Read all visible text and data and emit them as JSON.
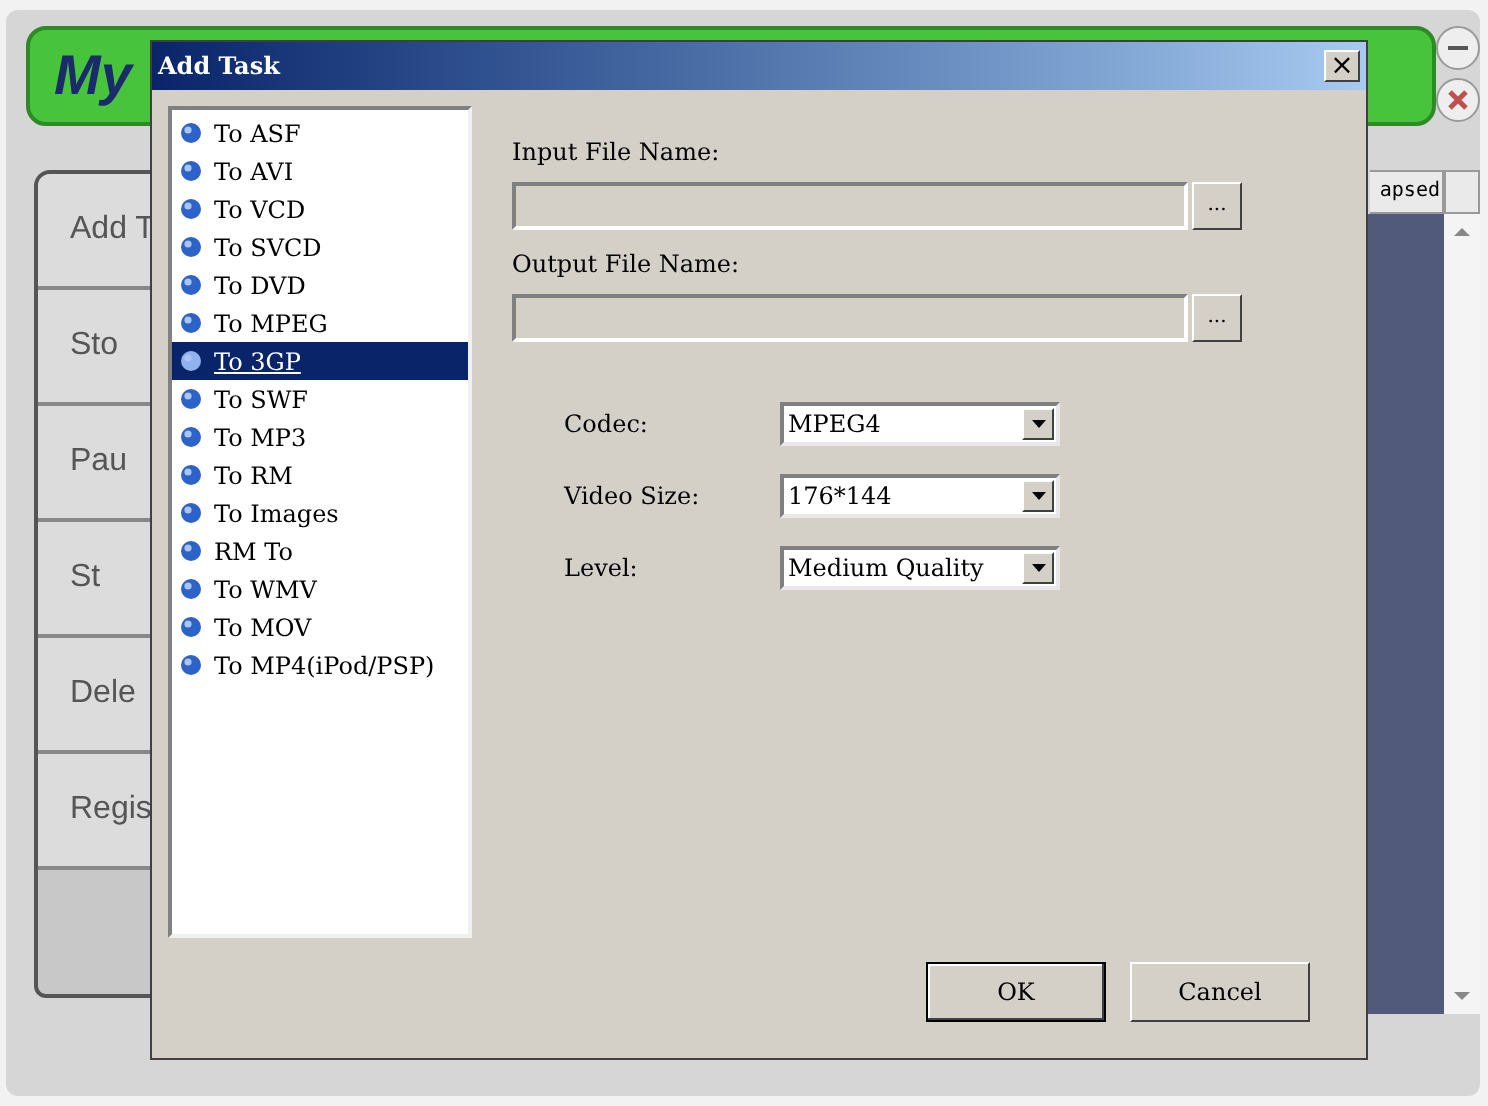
{
  "app": {
    "logo": "My",
    "side_buttons": [
      "Add T",
      "Sto",
      "Pau",
      "St",
      "Dele",
      "Regis"
    ],
    "column_header": "apsed"
  },
  "dialog": {
    "title": "Add Task",
    "close": "×",
    "tasks": [
      {
        "label": "To ASF",
        "selected": false
      },
      {
        "label": "To AVI",
        "selected": false
      },
      {
        "label": "To VCD",
        "selected": false
      },
      {
        "label": "To SVCD",
        "selected": false
      },
      {
        "label": "To DVD",
        "selected": false
      },
      {
        "label": "To MPEG",
        "selected": false
      },
      {
        "label": "To 3GP",
        "selected": true
      },
      {
        "label": "To SWF",
        "selected": false
      },
      {
        "label": "To MP3",
        "selected": false
      },
      {
        "label": "To RM",
        "selected": false
      },
      {
        "label": "To Images",
        "selected": false
      },
      {
        "label": "RM To",
        "selected": false
      },
      {
        "label": "To WMV",
        "selected": false
      },
      {
        "label": "To MOV",
        "selected": false
      },
      {
        "label": "To MP4(iPod/PSP)",
        "selected": false
      }
    ],
    "files": [
      {
        "label": "Input File Name:",
        "browse": "..."
      },
      {
        "label": "Output File Name:",
        "browse": "..."
      }
    ],
    "options": [
      {
        "label": "Codec:",
        "value": "MPEG4"
      },
      {
        "label": "Video Size:",
        "value": "176*144"
      },
      {
        "label": "Level:",
        "value": "Medium Quality"
      }
    ],
    "buttons": [
      "OK",
      "Cancel"
    ]
  }
}
